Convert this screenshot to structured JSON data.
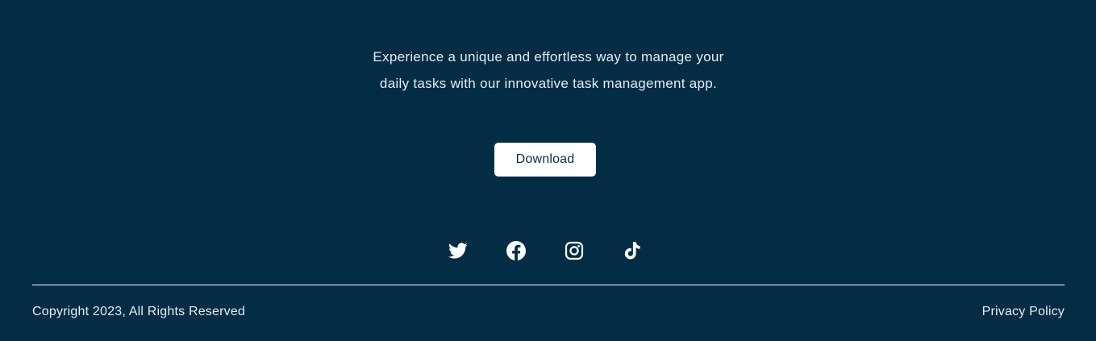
{
  "footer": {
    "tagline": "Experience a unique and effortless way to manage your daily tasks with our innovative task management app.",
    "download_label": "Download",
    "socials": [
      {
        "icon": "twitter-icon"
      },
      {
        "icon": "facebook-icon"
      },
      {
        "icon": "instagram-icon"
      },
      {
        "icon": "tiktok-icon"
      }
    ],
    "copyright": "Copyright 2023, All Rights Reserved",
    "privacy_label": "Privacy Policy"
  },
  "colors": {
    "background": "#032d45",
    "text": "#ffffff",
    "button_bg": "#ffffff",
    "button_text": "#032d45"
  }
}
